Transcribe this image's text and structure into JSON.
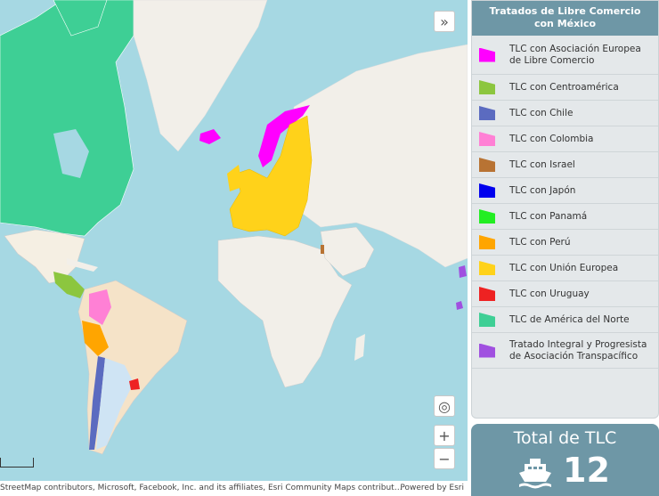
{
  "map": {
    "collapse_icon": "chevrons-down",
    "locate_icon": "locate-target",
    "zoom_in_label": "+",
    "zoom_out_label": "−"
  },
  "attribution": {
    "text": "StreetMap contributors, Microsoft, Facebook, Inc. and its affiliates, Esri Community Maps contribut…",
    "powered_by": "Powered by Esri"
  },
  "legend": {
    "title": "Tratados de Libre Comercio con México",
    "items": [
      {
        "label": "TLC con Asociación Europea de Libre Comercio",
        "color": "#ff00ff"
      },
      {
        "label": "TLC con Centroamérica",
        "color": "#8cc63f"
      },
      {
        "label": "TLC con Chile",
        "color": "#5b6bc0"
      },
      {
        "label": "TLC con Colombia",
        "color": "#ff80d5"
      },
      {
        "label": "TLC con Israel",
        "color": "#b87333"
      },
      {
        "label": "TLC con Japón",
        "color": "#0000ee"
      },
      {
        "label": "TLC con Panamá",
        "color": "#22ee22"
      },
      {
        "label": "TLC con Perú",
        "color": "#ffa500"
      },
      {
        "label": "TLC con Unión Europea",
        "color": "#ffd21a"
      },
      {
        "label": "TLC con Uruguay",
        "color": "#ee2222"
      },
      {
        "label": "TLC de América del Norte",
        "color": "#3ecf95"
      },
      {
        "label": "Tratado Integral y Progresista de Asociación Transpacífico",
        "color": "#a050e0"
      }
    ]
  },
  "total": {
    "title": "Total de TLC",
    "value": "12",
    "icon": "ship-icon"
  }
}
